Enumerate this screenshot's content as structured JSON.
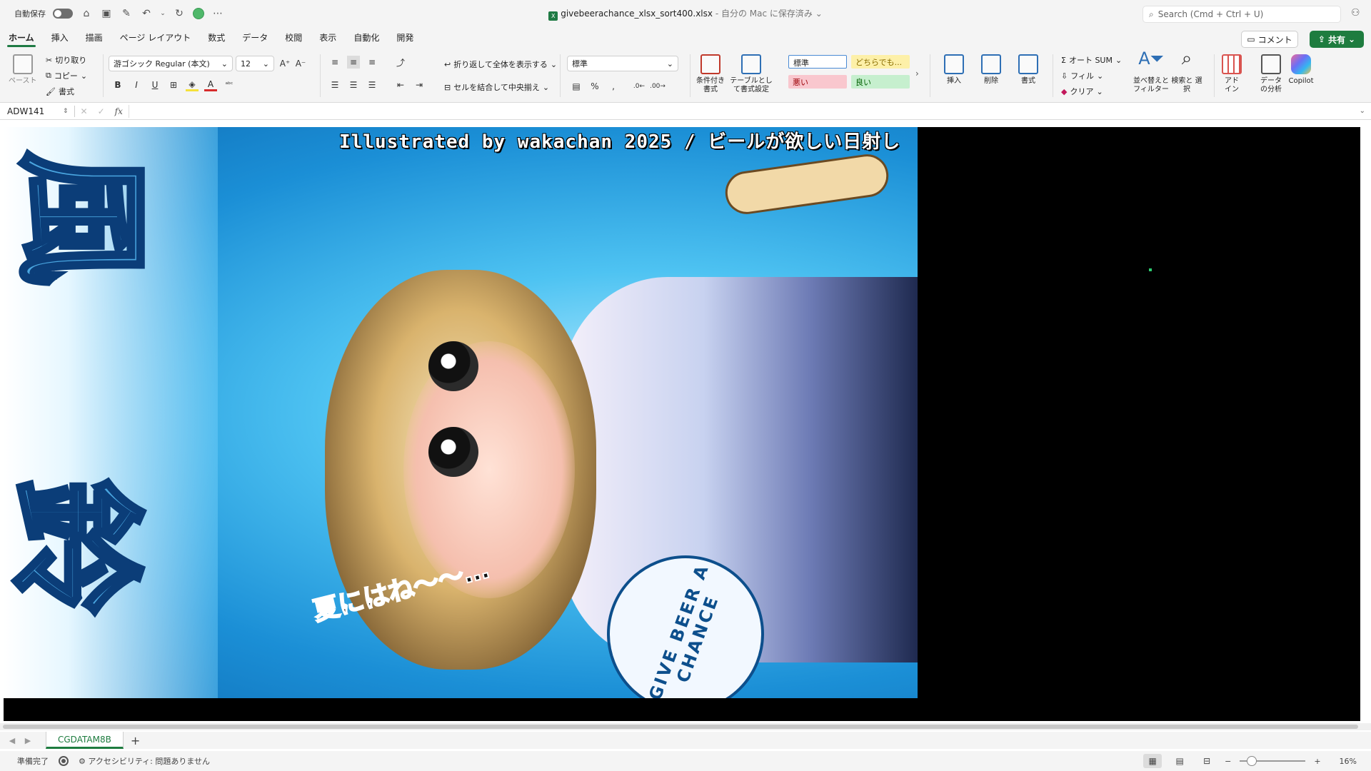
{
  "titlebar": {
    "autosave_label": "自動保存",
    "file_name": "givebeerachance_xlsx_sort400.xlsx",
    "save_location": "自分の Mac に保存済み",
    "search_placeholder": "Search (Cmd + Ctrl + U)"
  },
  "ribbon_tabs": [
    "ホーム",
    "挿入",
    "描画",
    "ページ レイアウト",
    "数式",
    "データ",
    "校閲",
    "表示",
    "自動化",
    "開発"
  ],
  "actions": {
    "comment": "コメント",
    "share": "共有"
  },
  "ribbon": {
    "paste": "ペースト",
    "cut": "切り取り",
    "copy": "コピー",
    "format_painter": "書式",
    "font_name": "游ゴシック Regular (本文)",
    "font_size": "12",
    "bold": "B",
    "italic": "I",
    "underline": "U",
    "wrap_text": "折り返して全体を表示する",
    "merge_center": "セルを結合して中央揃え",
    "number_format": "標準",
    "conditional_format": "条件付き 書式",
    "format_as_table": "テーブルとして書式設定",
    "styles": {
      "normal": "標準",
      "neutral": "どちらでも...",
      "bad": "悪い",
      "good": "良い"
    },
    "insert": "挿入",
    "delete": "削除",
    "format": "書式",
    "autosum": "オート SUM",
    "fill": "フィル",
    "clear": "クリア",
    "sort_filter": "並べ替えと フィルター",
    "find_select": "検索と 選択",
    "addins": "アド イン",
    "analyze_data": "データ の分析",
    "copilot": "Copilot"
  },
  "formula_bar": {
    "cell_ref": "ADW141",
    "fx": "fx",
    "value": ""
  },
  "artwork": {
    "caption": "Illustrated by wakachan 2025 / ビールが欲しい日射し",
    "kanji_top": "風",
    "kanji_bottom": "鈴",
    "speech": "夏にはね〜〜…",
    "fan_text": "GIVE BEER A CHANCE"
  },
  "sheet_tabs": {
    "active": "CGDATAM8B",
    "add": "+"
  },
  "statusbar": {
    "ready": "準備完了",
    "accessibility": "アクセシビリティ: 問題ありません",
    "zoom": "16%",
    "zoom_fraction": 0.16
  },
  "colors": {
    "accent": "#1e7c3f",
    "sheet_bg": "#000000"
  }
}
